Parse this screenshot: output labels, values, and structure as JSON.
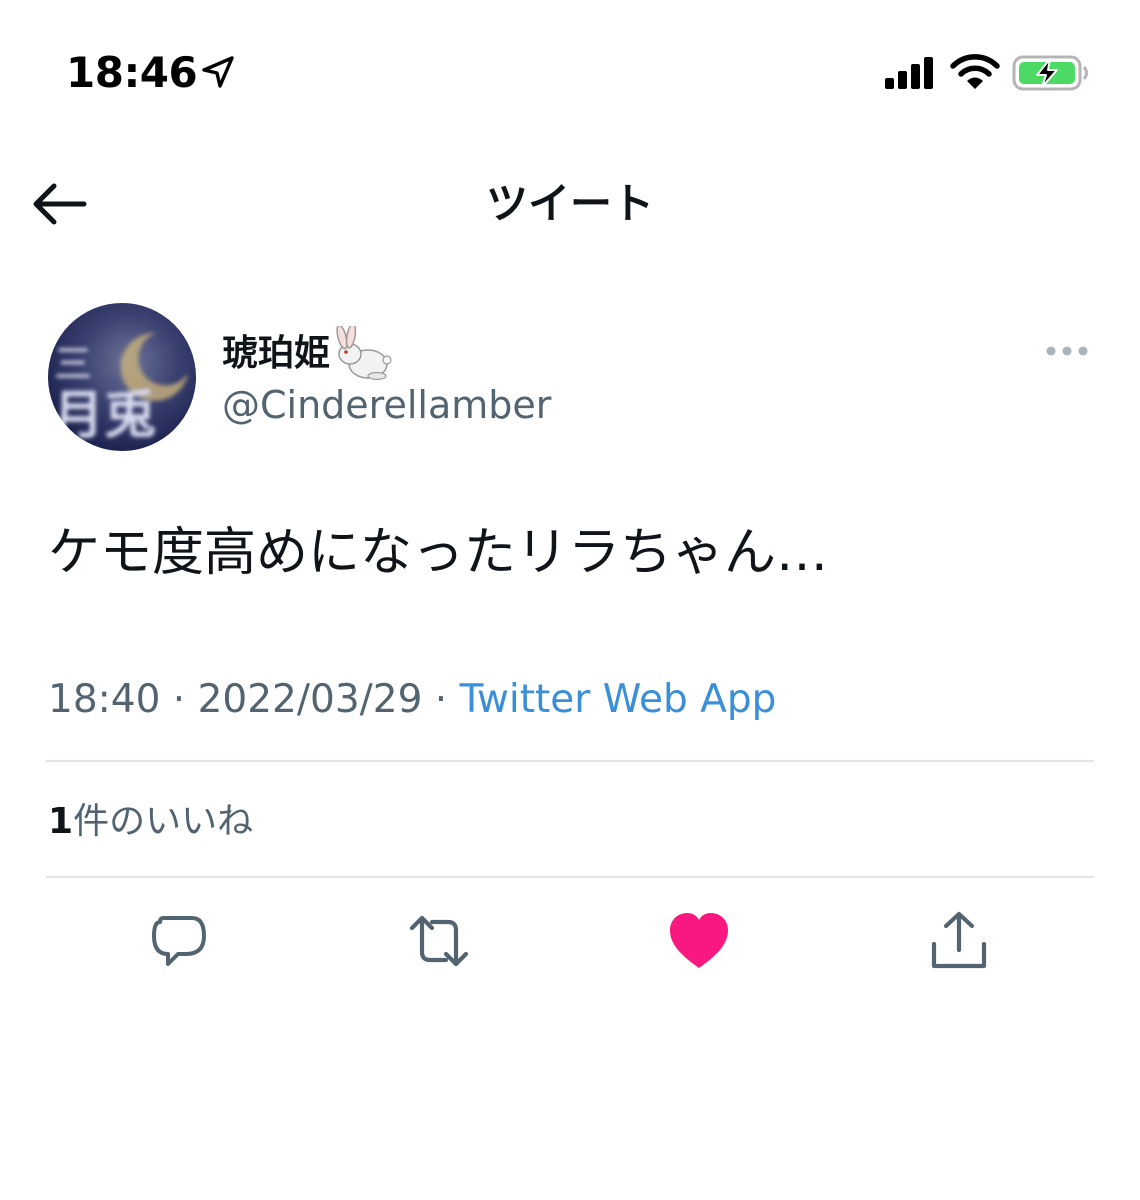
{
  "status_bar": {
    "time": "18:46",
    "icons": [
      "location-arrow-icon",
      "cellular-signal-icon",
      "wifi-icon",
      "battery-charging-icon"
    ],
    "battery_color": "#4cd964"
  },
  "header": {
    "title": "ツイート",
    "back_icon": "arrow-left-icon"
  },
  "tweet": {
    "author": {
      "display_name": "琥珀姫",
      "name_emoji": "rabbit-icon",
      "handle": "@Cinderellamber",
      "avatar_text": "月兎"
    },
    "text": "ケモ度高めになったリラちゃん…",
    "time": "18:40",
    "separator": " · ",
    "date": "2022/03/29",
    "source": "Twitter Web App",
    "likes": {
      "count": "1",
      "label": "件のいいね"
    }
  },
  "actions": [
    {
      "name": "reply",
      "icon": "reply-bubble-icon"
    },
    {
      "name": "retweet",
      "icon": "retweet-icon"
    },
    {
      "name": "like",
      "icon": "heart-icon",
      "active": true
    },
    {
      "name": "share",
      "icon": "share-icon"
    }
  ],
  "colors": {
    "text_primary": "#0f1419",
    "text_secondary": "#536471",
    "link": "#3a8fd8",
    "like_active": "#f91880",
    "divider": "#e1e5e9"
  }
}
